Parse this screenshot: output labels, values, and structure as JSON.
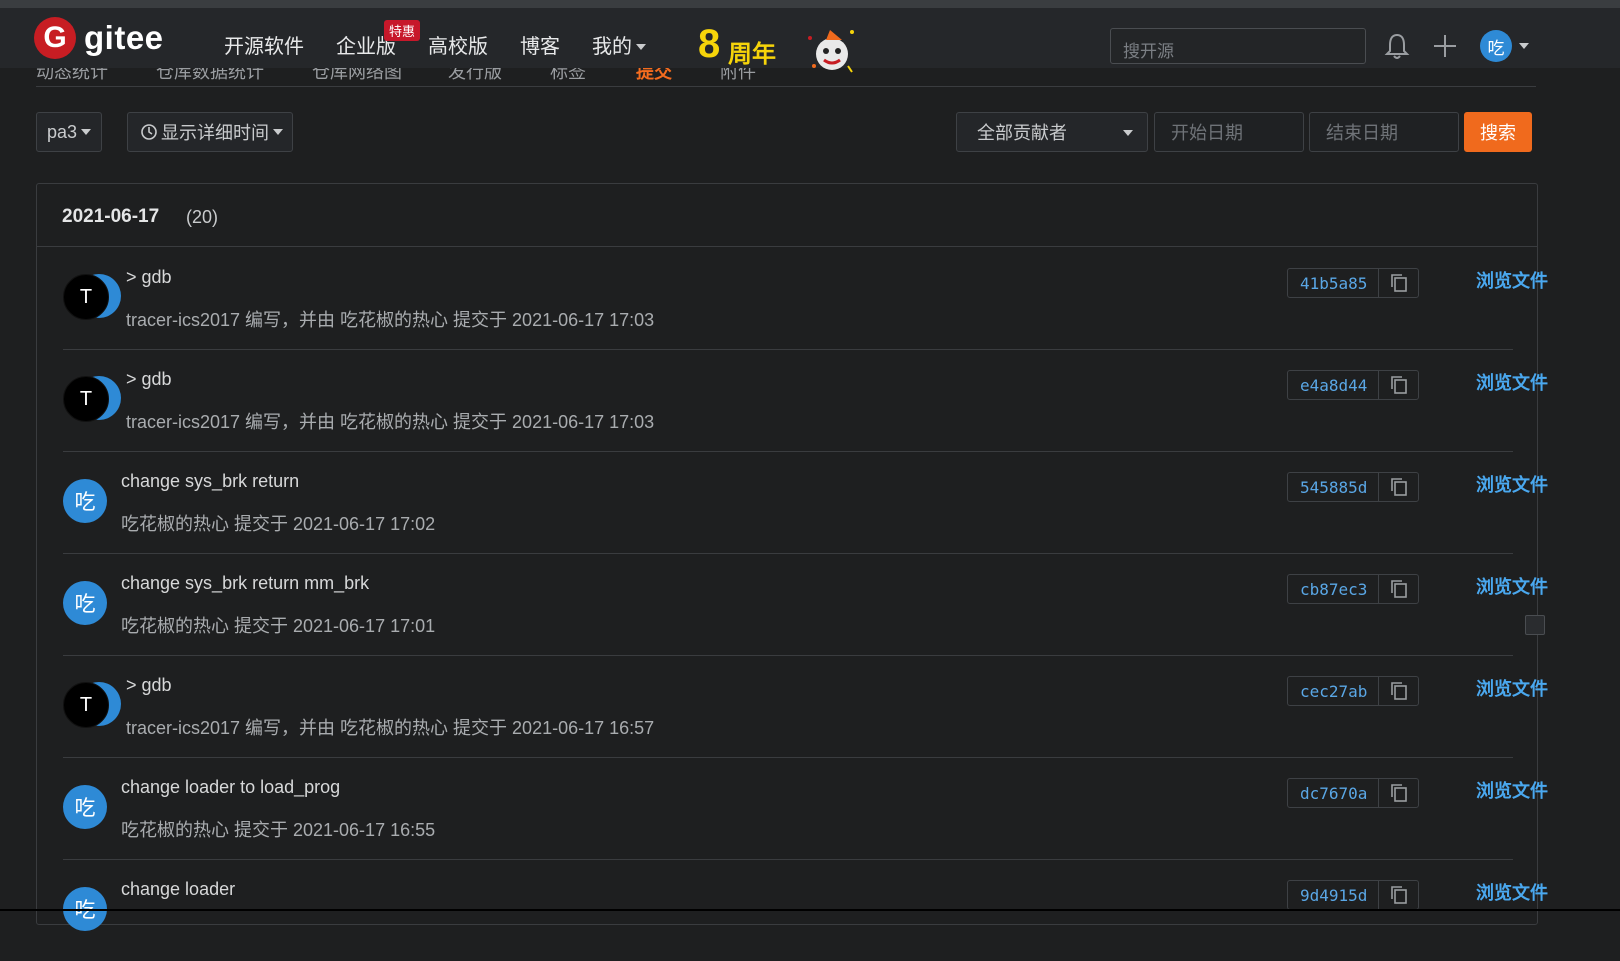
{
  "navbar": {
    "brand": "gitee",
    "brand_mark": "G",
    "links": [
      {
        "label": "开源软件"
      },
      {
        "label": "企业版",
        "badge": "特惠"
      },
      {
        "label": "高校版"
      },
      {
        "label": "博客"
      },
      {
        "label": "我的"
      }
    ],
    "anniversary_digit": "8",
    "anniversary_text": "周年",
    "search_placeholder": "搜开源",
    "user_avatar": "吃"
  },
  "subtabs": [
    "动态统计",
    "仓库数据统计",
    "仓库网络图",
    "发行版",
    "标签",
    "提交",
    "附件"
  ],
  "filters": {
    "branch": "pa3",
    "time_toggle": "显示详细时间",
    "contributor": "全部贡献者",
    "start_date_placeholder": "开始日期",
    "end_date_placeholder": "结束日期",
    "search_button": "搜索"
  },
  "group": {
    "date": "2021-06-17",
    "count": "(20)"
  },
  "commits": [
    {
      "avatar": "T",
      "message": "> gdb",
      "meta": "tracer-ics2017 编写，并由 吃花椒的热心 提交于 2021-06-17 17:03",
      "sha": "41b5a85",
      "browse": "浏览文件"
    },
    {
      "avatar": "T",
      "message": "> gdb",
      "meta": "tracer-ics2017 编写，并由 吃花椒的热心 提交于 2021-06-17 17:03",
      "sha": "e4a8d44",
      "browse": "浏览文件"
    },
    {
      "avatar": "吃",
      "message": "change sys_brk return",
      "meta": "吃花椒的热心 提交于 2021-06-17 17:02",
      "sha": "545885d",
      "browse": "浏览文件"
    },
    {
      "avatar": "吃",
      "message": "change sys_brk return mm_brk",
      "meta": "吃花椒的热心 提交于 2021-06-17 17:01",
      "sha": "cb87ec3",
      "browse": "浏览文件"
    },
    {
      "avatar": "T",
      "message": "> gdb",
      "meta": "tracer-ics2017 编写，并由 吃花椒的热心 提交于 2021-06-17 16:57",
      "sha": "cec27ab",
      "browse": "浏览文件"
    },
    {
      "avatar": "吃",
      "message": "change loader to load_prog",
      "meta": "吃花椒的热心 提交于 2021-06-17 16:55",
      "sha": "dc7670a",
      "browse": "浏览文件"
    },
    {
      "avatar": "吃",
      "message": "change loader",
      "meta": "",
      "sha": "9d4915d",
      "browse": "浏览文件"
    }
  ]
}
